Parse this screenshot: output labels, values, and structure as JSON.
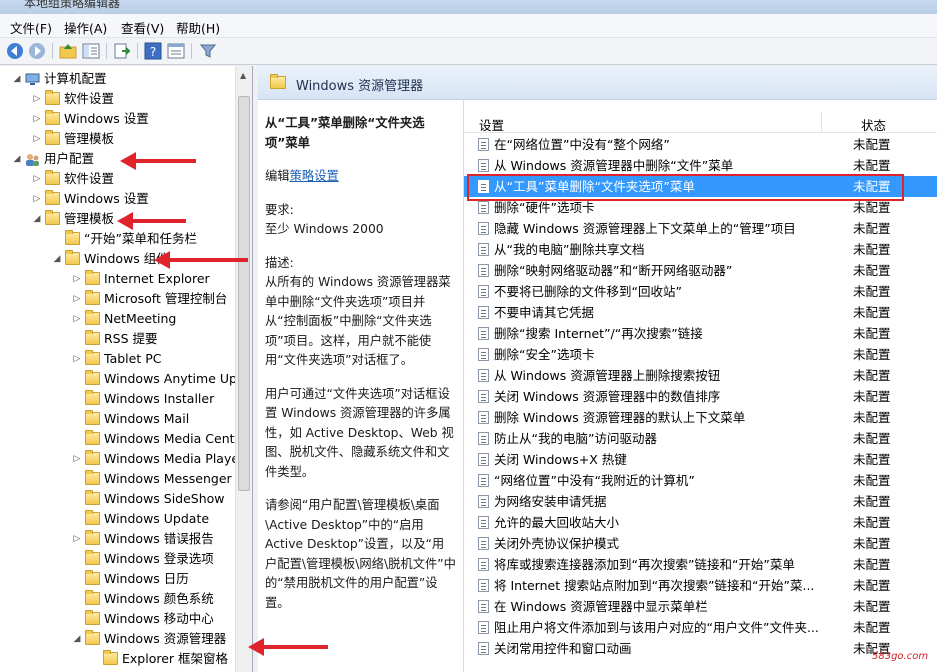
{
  "window": {
    "title": "本地组策略编辑器"
  },
  "menu": {
    "file": "文件(F)",
    "action": "操作(A)",
    "view": "查看(V)",
    "help": "帮助(H)"
  },
  "toolbar": {
    "icons": [
      "back-icon",
      "forward-icon",
      "up-folder-icon",
      "show-tree-icon",
      "export-icon",
      "help-icon",
      "properties-icon",
      "filter-icon"
    ]
  },
  "tree": {
    "items": [
      {
        "label": "计算机配置",
        "level": 0,
        "expanded": true,
        "icon": "computer-icon"
      },
      {
        "label": "软件设置",
        "level": 1,
        "expanded": false,
        "icon": "folder-icon"
      },
      {
        "label": "Windows 设置",
        "level": 1,
        "expanded": false,
        "icon": "folder-icon"
      },
      {
        "label": "管理模板",
        "level": 1,
        "expanded": false,
        "icon": "folder-icon"
      },
      {
        "label": "用户配置",
        "level": 0,
        "expanded": true,
        "icon": "user-icon"
      },
      {
        "label": "软件设置",
        "level": 1,
        "expanded": false,
        "icon": "folder-icon"
      },
      {
        "label": "Windows 设置",
        "level": 1,
        "expanded": false,
        "icon": "folder-icon"
      },
      {
        "label": "管理模板",
        "level": 1,
        "expanded": true,
        "icon": "folder-icon"
      },
      {
        "label": "“开始”菜单和任务栏",
        "level": 2,
        "expanded": null,
        "icon": "folder-icon"
      },
      {
        "label": "Windows 组件",
        "level": 2,
        "expanded": true,
        "icon": "folder-icon"
      },
      {
        "label": "Internet Explorer",
        "level": 3,
        "expanded": false,
        "icon": "folder-icon"
      },
      {
        "label": "Microsoft 管理控制台",
        "level": 3,
        "expanded": false,
        "icon": "folder-icon"
      },
      {
        "label": "NetMeeting",
        "level": 3,
        "expanded": false,
        "icon": "folder-icon"
      },
      {
        "label": "RSS 提要",
        "level": 3,
        "expanded": null,
        "icon": "folder-icon"
      },
      {
        "label": "Tablet PC",
        "level": 3,
        "expanded": false,
        "icon": "folder-icon"
      },
      {
        "label": "Windows Anytime Upg",
        "level": 3,
        "expanded": null,
        "icon": "folder-icon"
      },
      {
        "label": "Windows Installer",
        "level": 3,
        "expanded": null,
        "icon": "folder-icon"
      },
      {
        "label": "Windows Mail",
        "level": 3,
        "expanded": null,
        "icon": "folder-icon"
      },
      {
        "label": "Windows Media Center",
        "level": 3,
        "expanded": null,
        "icon": "folder-icon"
      },
      {
        "label": "Windows Media Player",
        "level": 3,
        "expanded": false,
        "icon": "folder-icon"
      },
      {
        "label": "Windows Messenger",
        "level": 3,
        "expanded": null,
        "icon": "folder-icon"
      },
      {
        "label": "Windows SideShow",
        "level": 3,
        "expanded": null,
        "icon": "folder-icon"
      },
      {
        "label": "Windows Update",
        "level": 3,
        "expanded": null,
        "icon": "folder-icon"
      },
      {
        "label": "Windows 错误报告",
        "level": 3,
        "expanded": false,
        "icon": "folder-icon"
      },
      {
        "label": "Windows 登录选项",
        "level": 3,
        "expanded": null,
        "icon": "folder-icon"
      },
      {
        "label": "Windows 日历",
        "level": 3,
        "expanded": null,
        "icon": "folder-icon"
      },
      {
        "label": "Windows 颜色系统",
        "level": 3,
        "expanded": null,
        "icon": "folder-icon"
      },
      {
        "label": "Windows 移动中心",
        "level": 3,
        "expanded": null,
        "icon": "folder-icon"
      },
      {
        "label": "Windows 资源管理器",
        "level": 3,
        "expanded": true,
        "icon": "folder-icon"
      },
      {
        "label": "Explorer 框架窗格",
        "level": 4,
        "expanded": null,
        "icon": "folder-icon"
      }
    ]
  },
  "right_header": {
    "title": "Windows 资源管理器"
  },
  "description": {
    "policy_title": "从“工具”菜单删除“文件夹选项”菜单",
    "edit_prefix": "编辑",
    "edit_link": "策略设置",
    "requirements_label": "要求:",
    "requirements_value": "至少 Windows 2000",
    "desc_label": "描述:",
    "desc_p1": "从所有的 Windows 资源管理器菜单中删除“文件夹选项”项目并从“控制面板”中删除“文件夹选项”项目。这样，用户就不能使用“文件夹选项”对话框了。",
    "desc_p2": "用户可通过“文件夹选项”对话框设置 Windows 资源管理器的许多属性，如 Active Desktop、Web 视图、脱机文件、隐藏系统文件和文件类型。",
    "desc_p3": "请参阅“用户配置\\管理模板\\桌面\\Active Desktop”中的“启用 Active Desktop”设置，以及“用户配置\\管理模板\\网络\\脱机文件”中的“禁用脱机文件的用户配置”设置。"
  },
  "list": {
    "col_setting": "设置",
    "col_state": "状态",
    "rows": [
      {
        "setting": "在“网络位置”中没有“整个网络”",
        "state": "未配置"
      },
      {
        "setting": "从 Windows 资源管理器中删除“文件”菜单",
        "state": "未配置"
      },
      {
        "setting": "从“工具”菜单删除“文件夹选项”菜单",
        "state": "未配置",
        "selected": true
      },
      {
        "setting": "删除“硬件”选项卡",
        "state": "未配置"
      },
      {
        "setting": "隐藏 Windows 资源管理器上下文菜单上的“管理”项目",
        "state": "未配置"
      },
      {
        "setting": "从“我的电脑”删除共享文档",
        "state": "未配置"
      },
      {
        "setting": "删除“映射网络驱动器”和“断开网络驱动器”",
        "state": "未配置"
      },
      {
        "setting": "不要将已删除的文件移到“回收站”",
        "state": "未配置"
      },
      {
        "setting": "不要申请其它凭据",
        "state": "未配置"
      },
      {
        "setting": "删除“搜索 Internet”/“再次搜索”链接",
        "state": "未配置"
      },
      {
        "setting": "删除“安全”选项卡",
        "state": "未配置"
      },
      {
        "setting": "从 Windows 资源管理器上删除搜索按钮",
        "state": "未配置"
      },
      {
        "setting": "关闭 Windows 资源管理器中的数值排序",
        "state": "未配置"
      },
      {
        "setting": "删除 Windows 资源管理器的默认上下文菜单",
        "state": "未配置"
      },
      {
        "setting": "防止从“我的电脑”访问驱动器",
        "state": "未配置"
      },
      {
        "setting": "关闭 Windows+X 热键",
        "state": "未配置"
      },
      {
        "setting": "“网络位置”中没有“我附近的计算机”",
        "state": "未配置"
      },
      {
        "setting": "为网络安装申请凭据",
        "state": "未配置"
      },
      {
        "setting": "允许的最大回收站大小",
        "state": "未配置"
      },
      {
        "setting": "关闭外壳协议保护模式",
        "state": "未配置"
      },
      {
        "setting": "将库或搜索连接器添加到“再次搜索”链接和“开始”菜单",
        "state": "未配置"
      },
      {
        "setting": "将 Internet 搜索站点附加到“再次搜索”链接和“开始”菜...",
        "state": "未配置"
      },
      {
        "setting": "在 Windows 资源管理器中显示菜单栏",
        "state": "未配置"
      },
      {
        "setting": "阻止用户将文件添加到与该用户对应的“用户文件”文件夹...",
        "state": "未配置"
      },
      {
        "setting": "关闭常用控件和窗口动画",
        "state": "未配置"
      }
    ]
  },
  "colors": {
    "selection": "#3399ff",
    "annotation": "#e0242b",
    "link": "#1a5fb4"
  },
  "watermark": "583go.com"
}
